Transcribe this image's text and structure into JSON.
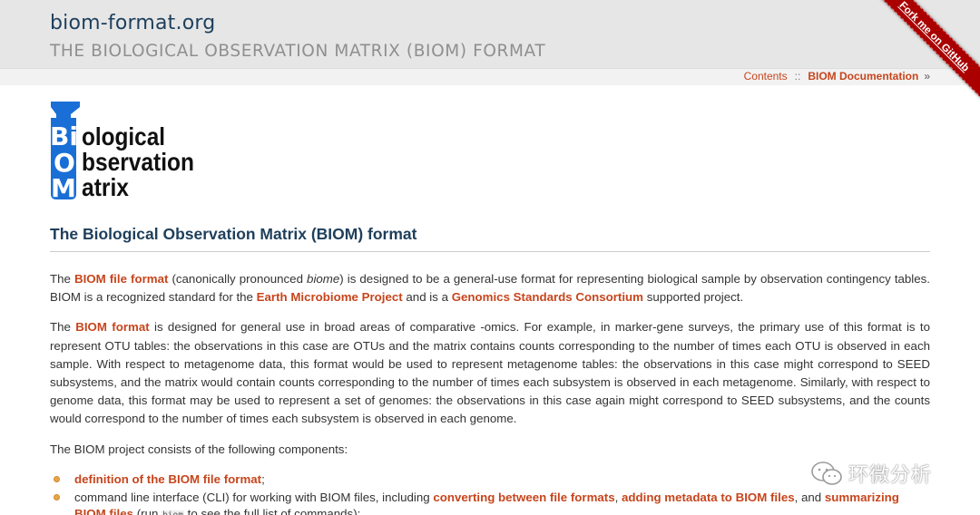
{
  "header": {
    "site_title": "biom-format.org",
    "site_subtitle": "THE BIOLOGICAL OBSERVATION MATRIX (BIOM) FORMAT"
  },
  "relbar": {
    "contents": "Contents",
    "separator": "::",
    "docs": "BIOM Documentation",
    "raquo": "»"
  },
  "ribbon": {
    "label": "Fork me on GitHub",
    "color": "#aa0000"
  },
  "logo": {
    "line1_letter": "Bi",
    "line1_rest": "ological",
    "line2_letter": "O",
    "line2_rest": "bservation",
    "line3_letter": "M",
    "line3_rest": "atrix",
    "color": "#1a6fd6"
  },
  "main": {
    "heading": "The Biological Observation Matrix (BIOM) format",
    "p1": {
      "t1": "The ",
      "link1": "BIOM file format",
      "t2": " (canonically pronounced ",
      "em": "biome",
      "t3": ") is designed to be a general-use format for representing biological sample by observation contingency tables. BIOM is a recognized standard for the ",
      "link2": "Earth Microbiome Project",
      "t4": " and is a ",
      "link3": "Genomics Standards Consortium",
      "t5": " supported project."
    },
    "p2": {
      "t1": "The ",
      "link1": "BIOM format",
      "t2": " is designed for general use in broad areas of comparative -omics. For example, in marker-gene surveys, the primary use of this format is to represent OTU tables: the observations in this case are OTUs and the matrix contains counts corresponding to the number of times each OTU is observed in each sample. With respect to metagenome data, this format would be used to represent metagenome tables: the observations in this case might correspond to SEED subsystems, and the matrix would contain counts corresponding to the number of times each subsystem is observed in each metagenome. Similarly, with respect to genome data, this format may be used to represent a set of genomes: the observations in this case again might correspond to SEED subsystems, and the counts would correspond to the number of times each subsystem is observed in each genome."
    },
    "p3": "The BIOM project consists of the following components:",
    "components": {
      "item1": {
        "link": "definition of the BIOM file format",
        "tail": ";"
      },
      "item2": {
        "t1": "command line interface (CLI) for working with BIOM files, including ",
        "link1": "converting between file formats",
        "t2": ", ",
        "link2": "adding metadata to BIOM files",
        "t3": ", and ",
        "link3": "summarizing BIOM files",
        "t4": " (run ",
        "code": "biom",
        "t5": " to see the full list of commands);"
      }
    }
  },
  "watermark": {
    "text": "环微分析",
    "icon": "wechat-icon"
  },
  "colors": {
    "link": "#c7451c",
    "heading": "#1e3f5c",
    "header_bg": "#e6e6e6",
    "bullet": "#e8a64b"
  }
}
